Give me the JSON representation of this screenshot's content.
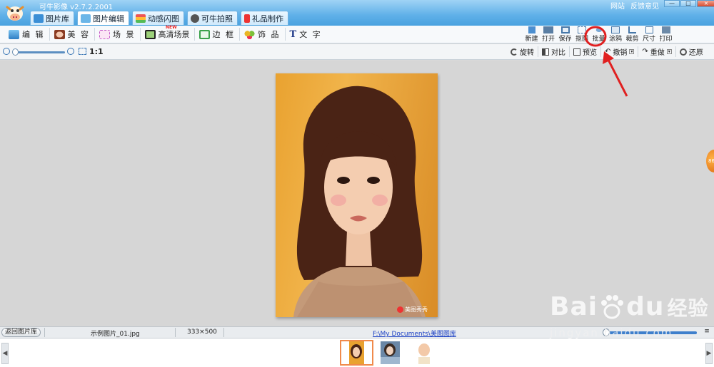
{
  "app": {
    "title": "可牛影像 v2.7.2.2001",
    "links": [
      "网站",
      "反馈意见"
    ],
    "window_buttons": [
      "—",
      "□",
      "×"
    ]
  },
  "main_tabs": [
    {
      "label": "图片库",
      "icon": "gallery-icon",
      "active": false
    },
    {
      "label": "图片编辑",
      "icon": "image-edit-icon",
      "active": true
    },
    {
      "label": "动感闪图",
      "icon": "animation-icon",
      "active": false
    },
    {
      "label": "可牛拍照",
      "icon": "camera-icon",
      "active": false
    },
    {
      "label": "礼品制作",
      "icon": "gift-icon",
      "active": false
    }
  ],
  "tools": [
    {
      "label": "编 辑",
      "icon": "edit-icon"
    },
    {
      "label": "美 容",
      "icon": "beauty-icon"
    },
    {
      "label": "场 景",
      "icon": "scene-icon"
    },
    {
      "label": "高清场景",
      "icon": "hd-scene-icon"
    },
    {
      "label": "边 框",
      "icon": "frame-icon"
    },
    {
      "label": "饰 品",
      "icon": "accessory-icon"
    },
    {
      "label": "文 字",
      "icon": "text-icon"
    }
  ],
  "hd_badge": "NEW",
  "right_tools": [
    {
      "label": "新建",
      "icon": "new-icon"
    },
    {
      "label": "打开",
      "icon": "open-icon"
    },
    {
      "label": "保存",
      "icon": "save-icon"
    },
    {
      "label": "抠图",
      "icon": "cutout-icon"
    },
    {
      "label": "批量",
      "icon": "batch-icon"
    },
    {
      "label": "涂鸦",
      "icon": "doodle-icon"
    },
    {
      "label": "裁剪",
      "icon": "crop-icon"
    },
    {
      "label": "尺寸",
      "icon": "resize-icon"
    },
    {
      "label": "打印",
      "icon": "print-icon"
    }
  ],
  "zoom": {
    "ratio_label": "1:1"
  },
  "sub_tools": [
    {
      "label": "旋转",
      "icon": "rotate-icon"
    },
    {
      "label": "对比",
      "icon": "compare-icon"
    },
    {
      "label": "预览",
      "icon": "preview-icon"
    },
    {
      "label": "撤销",
      "icon": "undo-icon"
    },
    {
      "label": "重做",
      "icon": "redo-icon"
    },
    {
      "label": "还原",
      "icon": "restore-icon"
    }
  ],
  "photo": {
    "watermark": "美图秀秀"
  },
  "side_ball": "86",
  "status": {
    "back_label": "返回图片库",
    "file_name": "示例图片_01.jpg",
    "dimensions": "333×500",
    "path": "F:\\My Documents\\美图图库"
  },
  "baidu": {
    "brand": "Bai",
    "brand2": "du",
    "cn": "经验",
    "url": "jingyan.baidu.com"
  },
  "colors": {
    "accent": "#4aa2df",
    "highlight": "#e02020"
  }
}
